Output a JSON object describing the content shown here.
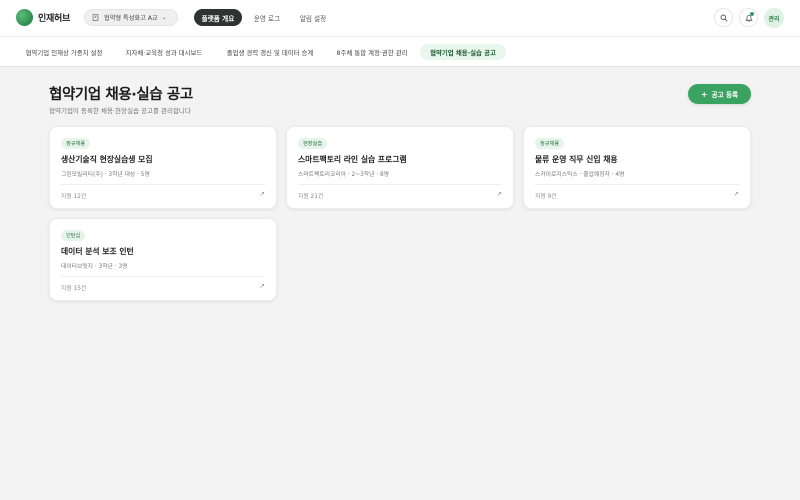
{
  "brand": {
    "name": "인재허브"
  },
  "school_select": {
    "value": "협약형 특성화고 A교"
  },
  "nav": [
    {
      "label": "플랫폼 개요",
      "active": true
    },
    {
      "label": "운영 로그",
      "active": false
    },
    {
      "label": "알림 설정",
      "active": false
    }
  ],
  "header_icons": {
    "search": "search-icon",
    "notifications": "bell-icon",
    "admin_label": "관리"
  },
  "subtabs": [
    {
      "label": "협약기업 인재상 가중치 설정",
      "active": false
    },
    {
      "label": "지자체·교육청 성과 대시보드",
      "active": false
    },
    {
      "label": "졸업생 경력 갱신 및 데이터 승계",
      "active": false
    },
    {
      "label": "8주체 통합 계정·권한 관리",
      "active": false
    },
    {
      "label": "협약기업 채용·실습 공고",
      "active": true
    }
  ],
  "page": {
    "title": "협약기업 채용·실습 공고",
    "subtitle": "협약기업이 등록한 채용·현장실습 공고를 관리합니다",
    "add_button": "공고 등록"
  },
  "postings": [
    {
      "badge": "정규채용",
      "title": "생산기술직 현장실습생 모집",
      "meta": "그린모빌리티(주) · 3학년 대상 · 5명",
      "applicants": "지원 12건"
    },
    {
      "badge": "현장실습",
      "title": "스마트팩토리 라인 실습 프로그램",
      "meta": "스마트팩토리코리아 · 2~3학년 · 8명",
      "applicants": "지원 21건"
    },
    {
      "badge": "정규채용",
      "title": "물류 운영 직무 신입 채용",
      "meta": "스카이로지스틱스 · 졸업예정자 · 4명",
      "applicants": "지원 9건"
    },
    {
      "badge": "인턴십",
      "title": "데이터 분석 보조 인턴",
      "meta": "데이터브릿지 · 3학년 · 3명",
      "applicants": "지원 15건"
    }
  ],
  "colors": {
    "accent": "#3aa361",
    "dark_pill": "#2f3331",
    "badge_bg": "#e6f5ea"
  }
}
